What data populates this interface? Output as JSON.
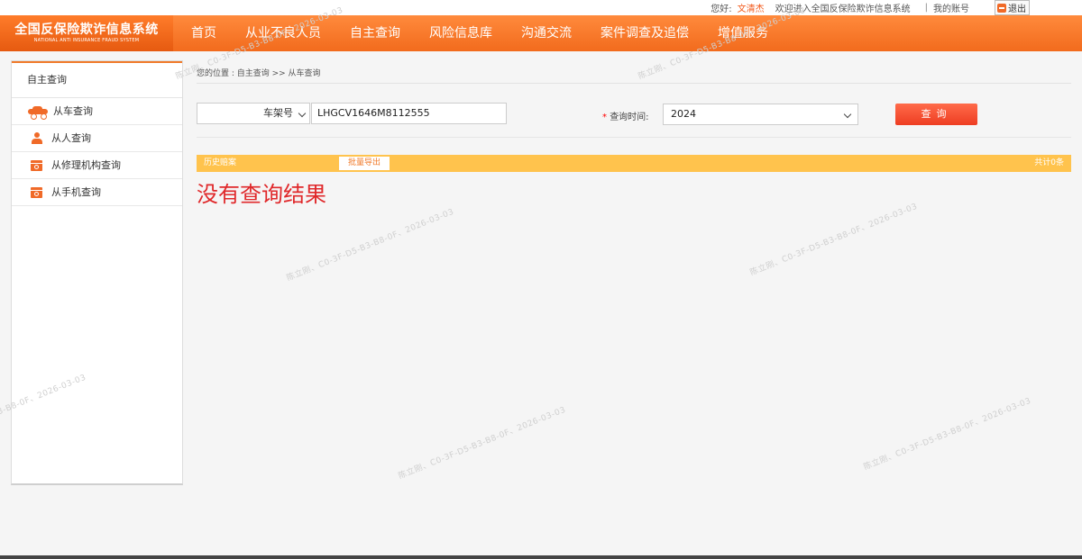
{
  "topbar": {
    "greeting": "您好:",
    "username": "文清杰",
    "welcome": "欢迎进入全国反保险欺诈信息系统",
    "separator": "|",
    "my_account": "我的账号",
    "logout": "退出"
  },
  "logo": {
    "title_cn": "全国反保险欺诈信息系统",
    "title_en": "NATIONAL ANTI INSURANCE FRAUD SYSTEM"
  },
  "nav": {
    "items": [
      "首页",
      "从业不良人员",
      "自主查询",
      "风险信息库",
      "沟通交流",
      "案件调查及追偿",
      "增值服务"
    ]
  },
  "sidebar": {
    "title": "自主查询",
    "items": [
      {
        "label": "从车查询",
        "icon": "car-icon"
      },
      {
        "label": "从人查询",
        "icon": "person-icon"
      },
      {
        "label": "从修理机构查询",
        "icon": "garage-icon"
      },
      {
        "label": "从手机查询",
        "icon": "phone-icon"
      }
    ]
  },
  "breadcrumb": "您的位置 : 自主查询 >> 从车查询",
  "form": {
    "type_selected": "车架号",
    "vin_value": "LHGCV1646M8112555",
    "time_required_mark": "*",
    "time_label": "查询时间:",
    "year_selected": "2024",
    "query_button": "查询"
  },
  "results": {
    "history_label": "历史赔案",
    "export_button": "批量导出",
    "count_text": "共计0条",
    "empty_text": "没有查询结果"
  },
  "watermark": "陈立刚、C0-3F-D5-B3-B8-0F、2026-03-03",
  "colors": {
    "brand_orange": "#f26b1d",
    "result_bar": "#ffc34d",
    "query_button": "#ee3d22",
    "empty_text": "#e0282a"
  }
}
